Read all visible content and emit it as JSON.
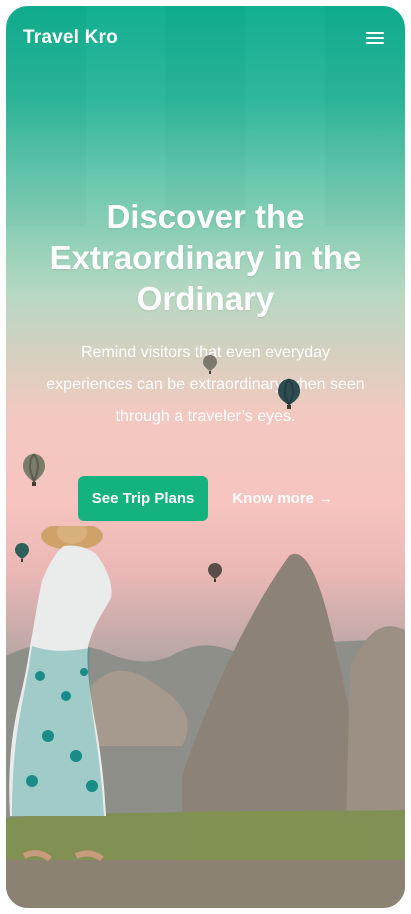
{
  "header": {
    "brand": "Travel Kro",
    "menu_icon": "hamburger-menu-icon"
  },
  "hero": {
    "title": "Discover the Extraordinary in the Ordinary",
    "subtitle": "Remind visitors that even everyday experiences can be extraordinary when seen through a traveler’s eyes.",
    "primary_cta": "See Trip Plans",
    "secondary_cta": "Know more →"
  },
  "colors": {
    "accent": "#13b27f",
    "top_gradient": "#0fae8f",
    "sky_pink": "#f7c4bf"
  }
}
